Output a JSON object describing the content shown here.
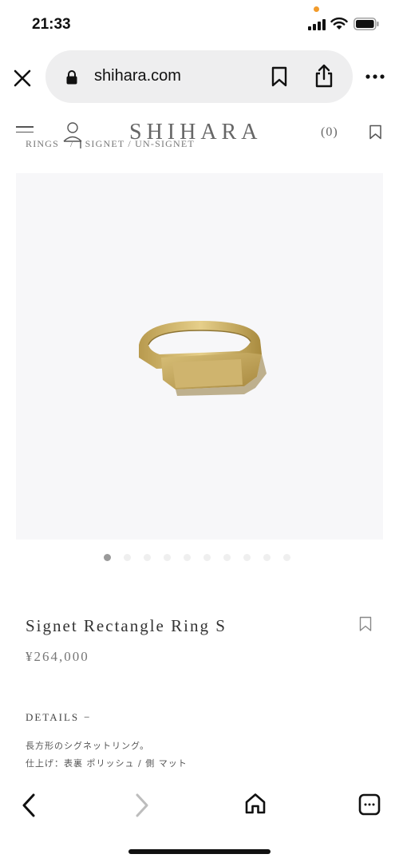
{
  "status_bar": {
    "time": "21:33",
    "dot_color": "#f29b2b",
    "icons": [
      "signal-icon",
      "wifi-icon",
      "battery-icon"
    ]
  },
  "browser": {
    "url": "shihara.com",
    "icons": [
      "close-icon",
      "lock-icon",
      "bookmark-icon",
      "share-icon",
      "more-icon"
    ]
  },
  "site_header": {
    "brand": "SHIHARA",
    "cart_count": "(0)",
    "breadcrumb": [
      "RINGS",
      "SIGNET / UN-SIGNET"
    ],
    "breadcrumb_separator": "/",
    "icons": [
      "menu-icon",
      "user-icon",
      "bookmark-icon"
    ]
  },
  "carousel": {
    "total": 10,
    "active_index": 0
  },
  "product": {
    "title": "Signet Rectangle Ring S",
    "price": "¥264,000",
    "details_label": "DETAILS",
    "details_toggle": "−",
    "details_lines": [
      "長方形のシグネットリング。",
      "仕上げ：表裏 ポリッシュ / 側 マット"
    ]
  },
  "bottom_toolbar": {
    "icons": [
      "back-icon",
      "forward-icon",
      "home-icon",
      "tabs-icon"
    ]
  }
}
